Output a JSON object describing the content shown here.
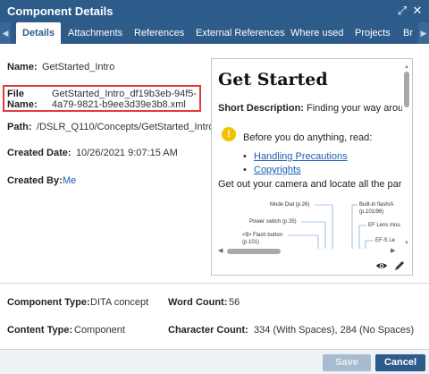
{
  "dialog": {
    "title": "Component Details",
    "expand_icon": "expand-icon",
    "close_icon": "close-icon"
  },
  "tabs": [
    "Details",
    "Attachments",
    "References",
    "External References",
    "Where used",
    "Projects",
    "Br"
  ],
  "fields": {
    "name_label": "Name:",
    "name_value": "GetStarted_Intro",
    "file_label_1": "File",
    "file_label_2": "Name:",
    "file_value_1": "GetStarted_Intro_df19b3eb-94f5-",
    "file_value_2": "4a79-9821-b9ee3d39e3b8.xml",
    "path_label": "Path:",
    "path_value": "/DSLR_Q110/Concepts/GetStarted_Intro",
    "created_date_label": "Created Date:",
    "created_date_value": "10/26/2021 9:07:15 AM",
    "created_by_label": "Created By:",
    "created_by_value": "Me",
    "component_type_label": "Component Type:",
    "component_type_value": "DITA concept",
    "word_count_label": "Word Count:",
    "word_count_value": "56",
    "content_type_label": "Content Type:",
    "content_type_value": "Component",
    "char_count_label": "Character Count:",
    "char_count_value": "334 (With Spaces), 284 (No Spaces)"
  },
  "preview": {
    "heading": "Get Started",
    "short_label": "Short Description:",
    "short_text": "Finding your way arou",
    "note_text": "Before you do anything, read:",
    "links": [
      "Handling Precautions",
      "Copyrights"
    ],
    "para": "Get out your camera and locate all the par",
    "diagram_labels": {
      "mode_dial": "Mode Dial (p.26)",
      "builtin_flash": "Built-in flash/A",
      "builtin_flash_2": "(p.101/96)",
      "power_switch": "Power switch (p.35)",
      "ef_lens": "EF Lens mou",
      "flash_button": "<$> Flash button",
      "flash_button_2": "(p.101)",
      "efs_lens": "EF-S Le"
    },
    "view_icon": "eye-icon",
    "edit_icon": "pencil-icon"
  },
  "buttons": {
    "save": "Save",
    "cancel": "Cancel"
  },
  "colors": {
    "header": "#2d5b8a",
    "highlight_box": "#e03c3c",
    "link": "#1a5fb4",
    "note": "#f2c200"
  }
}
